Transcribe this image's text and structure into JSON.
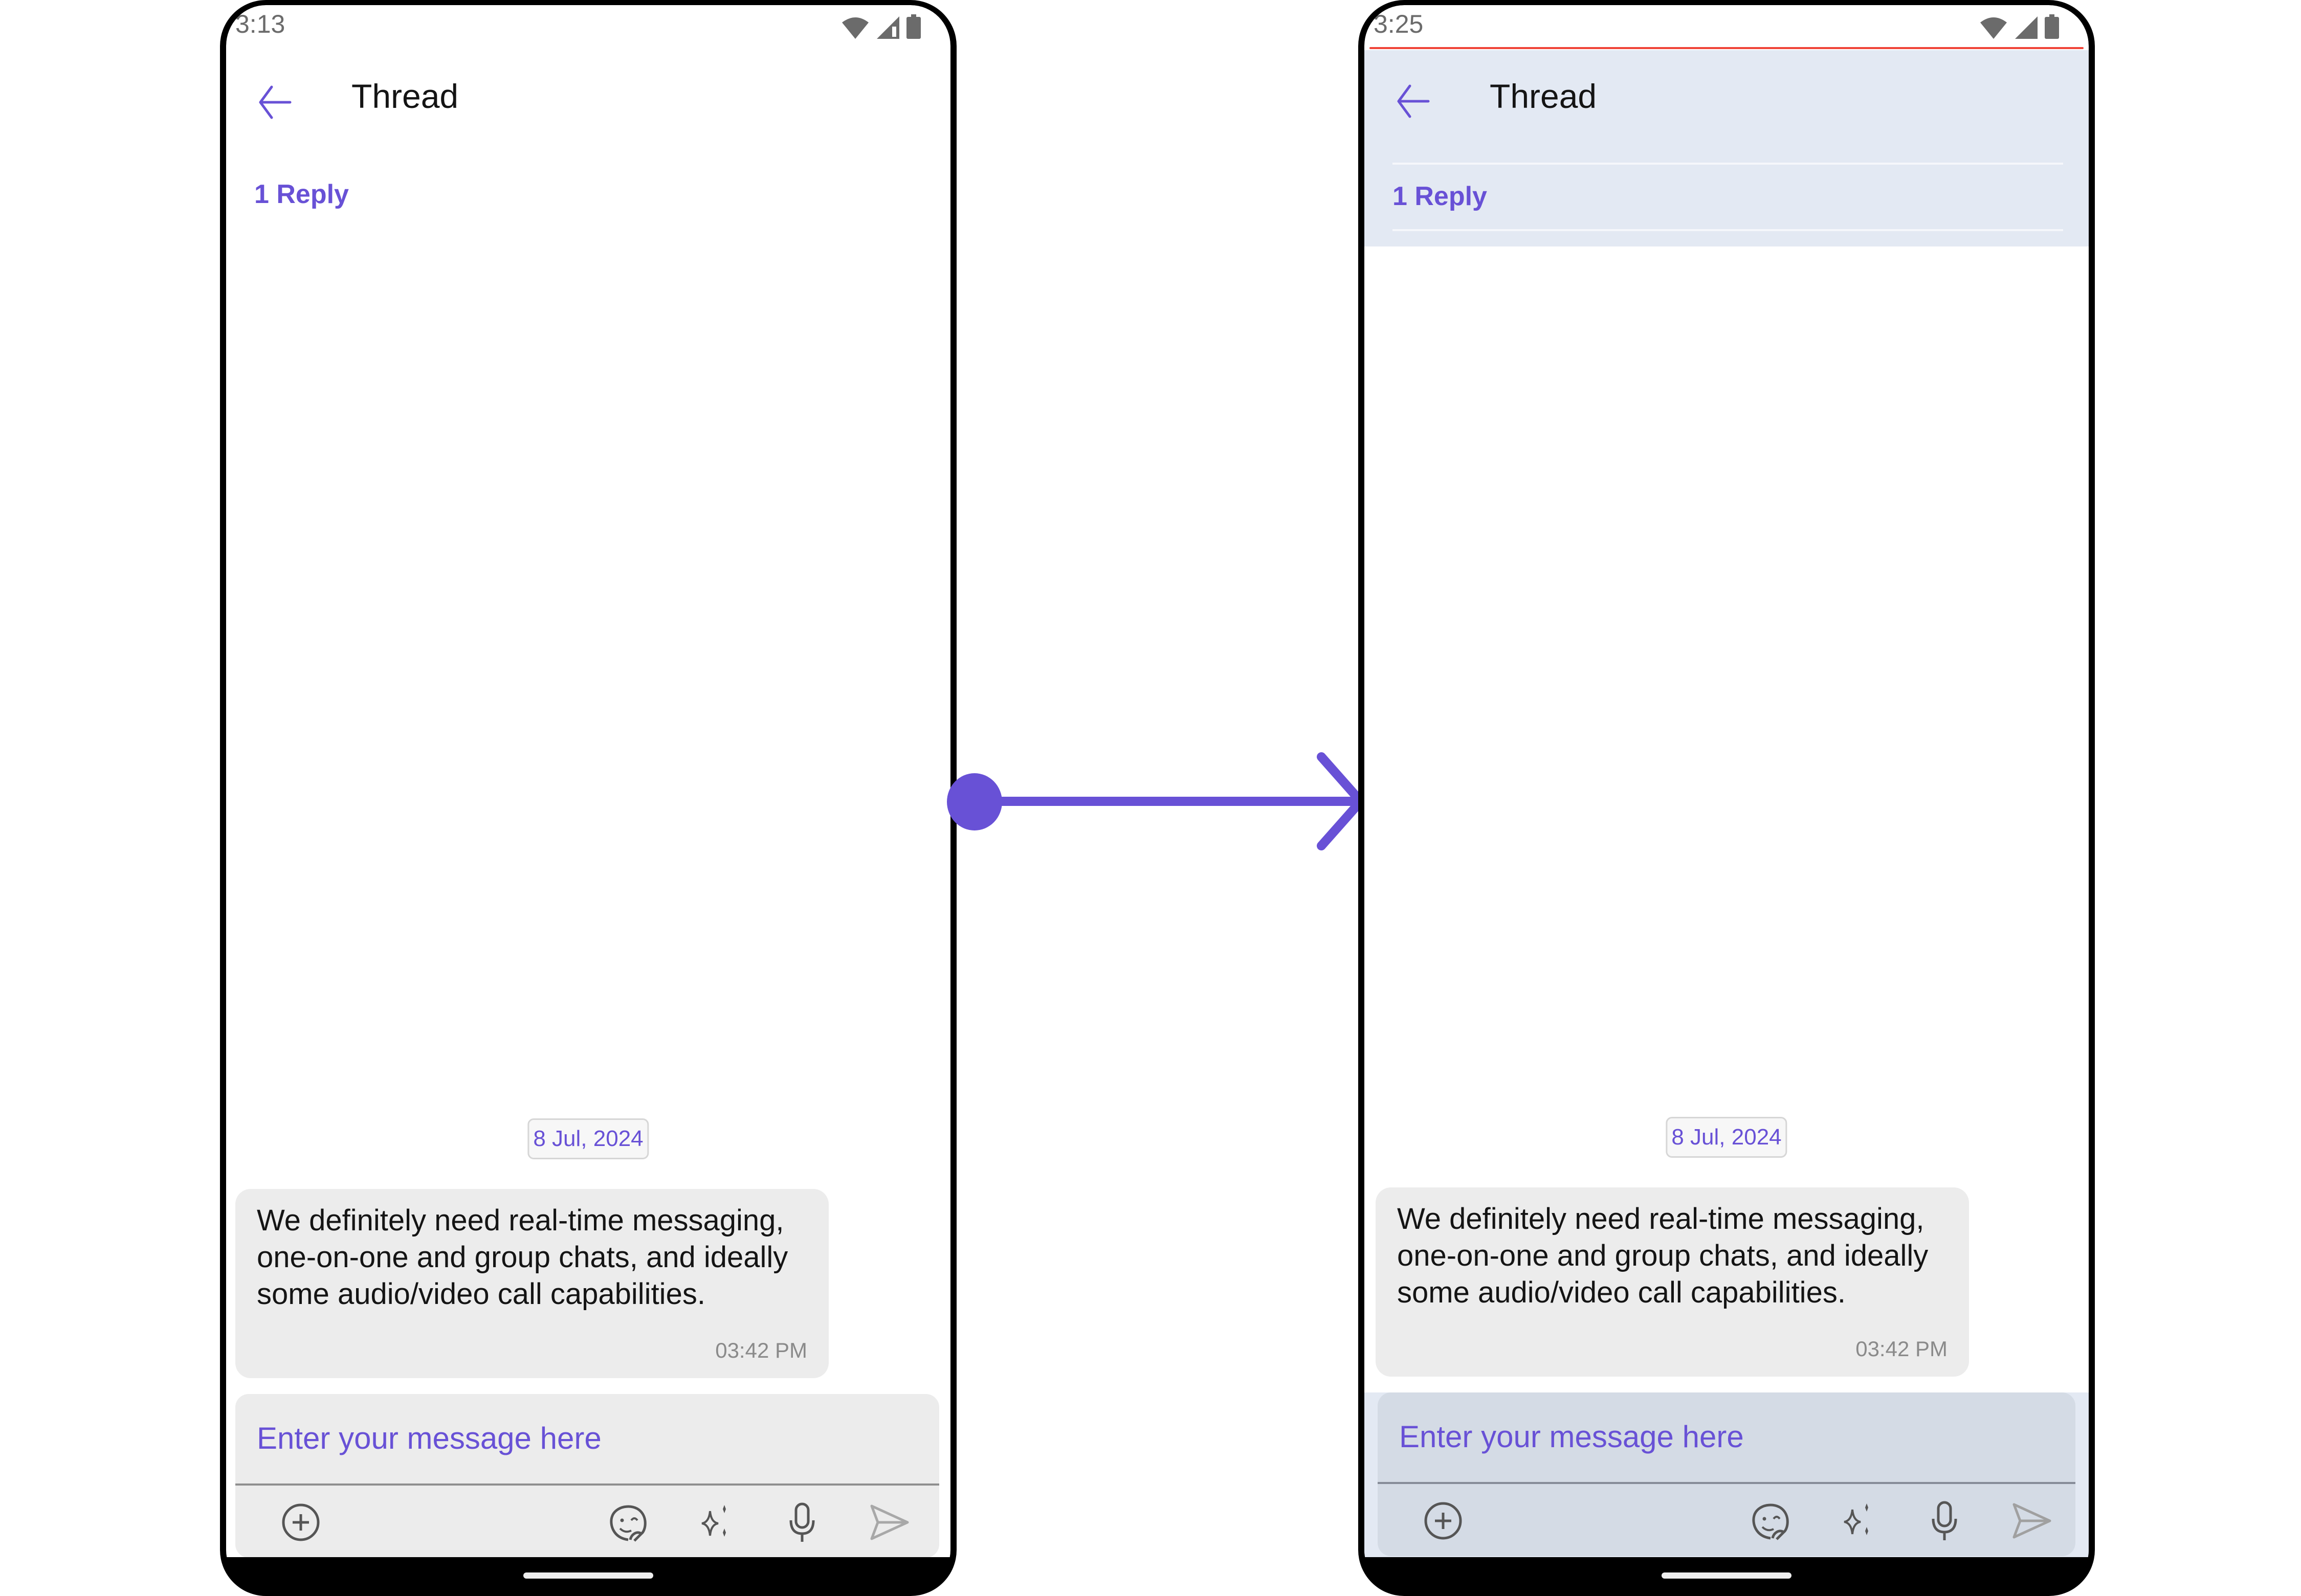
{
  "colors": {
    "accent": "#6851d6",
    "header_highlight": "#e3e9f3",
    "composer_highlight": "#d4dbe5",
    "bubble": "#ececec",
    "highlight_border": "#f04438"
  },
  "screens": [
    {
      "id": "before",
      "status_bar": {
        "time": "3:13",
        "icons": [
          "wifi-icon",
          "cellular-signal-icon",
          "battery-icon"
        ]
      },
      "header": {
        "back_icon": "arrow-left-icon",
        "title": "Thread"
      },
      "reply_count": "1 Reply",
      "date_separator": "8 Jul, 2024",
      "message": {
        "text": "We definitely need real-time messaging, one-on-one and group chats, and ideally some audio/video call capabilities.",
        "time": "03:42 PM"
      },
      "composer": {
        "placeholder": "Enter your message here",
        "tools": [
          "add-attachment-icon",
          "sticker-icon",
          "ai-sparkle-icon",
          "microphone-icon",
          "send-icon"
        ]
      }
    },
    {
      "id": "after",
      "status_bar": {
        "time": "3:25",
        "icons": [
          "wifi-icon",
          "cellular-signal-icon",
          "battery-icon"
        ]
      },
      "header": {
        "back_icon": "arrow-left-icon",
        "title": "Thread"
      },
      "reply_count": "1 Reply",
      "date_separator": "8 Jul, 2024",
      "message": {
        "text": "We definitely need real-time messaging, one-on-one and group chats, and ideally some audio/video call capabilities.",
        "time": "03:42 PM"
      },
      "composer": {
        "placeholder": "Enter your message here",
        "tools": [
          "add-attachment-icon",
          "sticker-icon",
          "ai-sparkle-icon",
          "microphone-icon",
          "send-icon"
        ]
      }
    }
  ],
  "connector": {
    "direction": "left-to-right",
    "from": "before",
    "to": "after"
  }
}
